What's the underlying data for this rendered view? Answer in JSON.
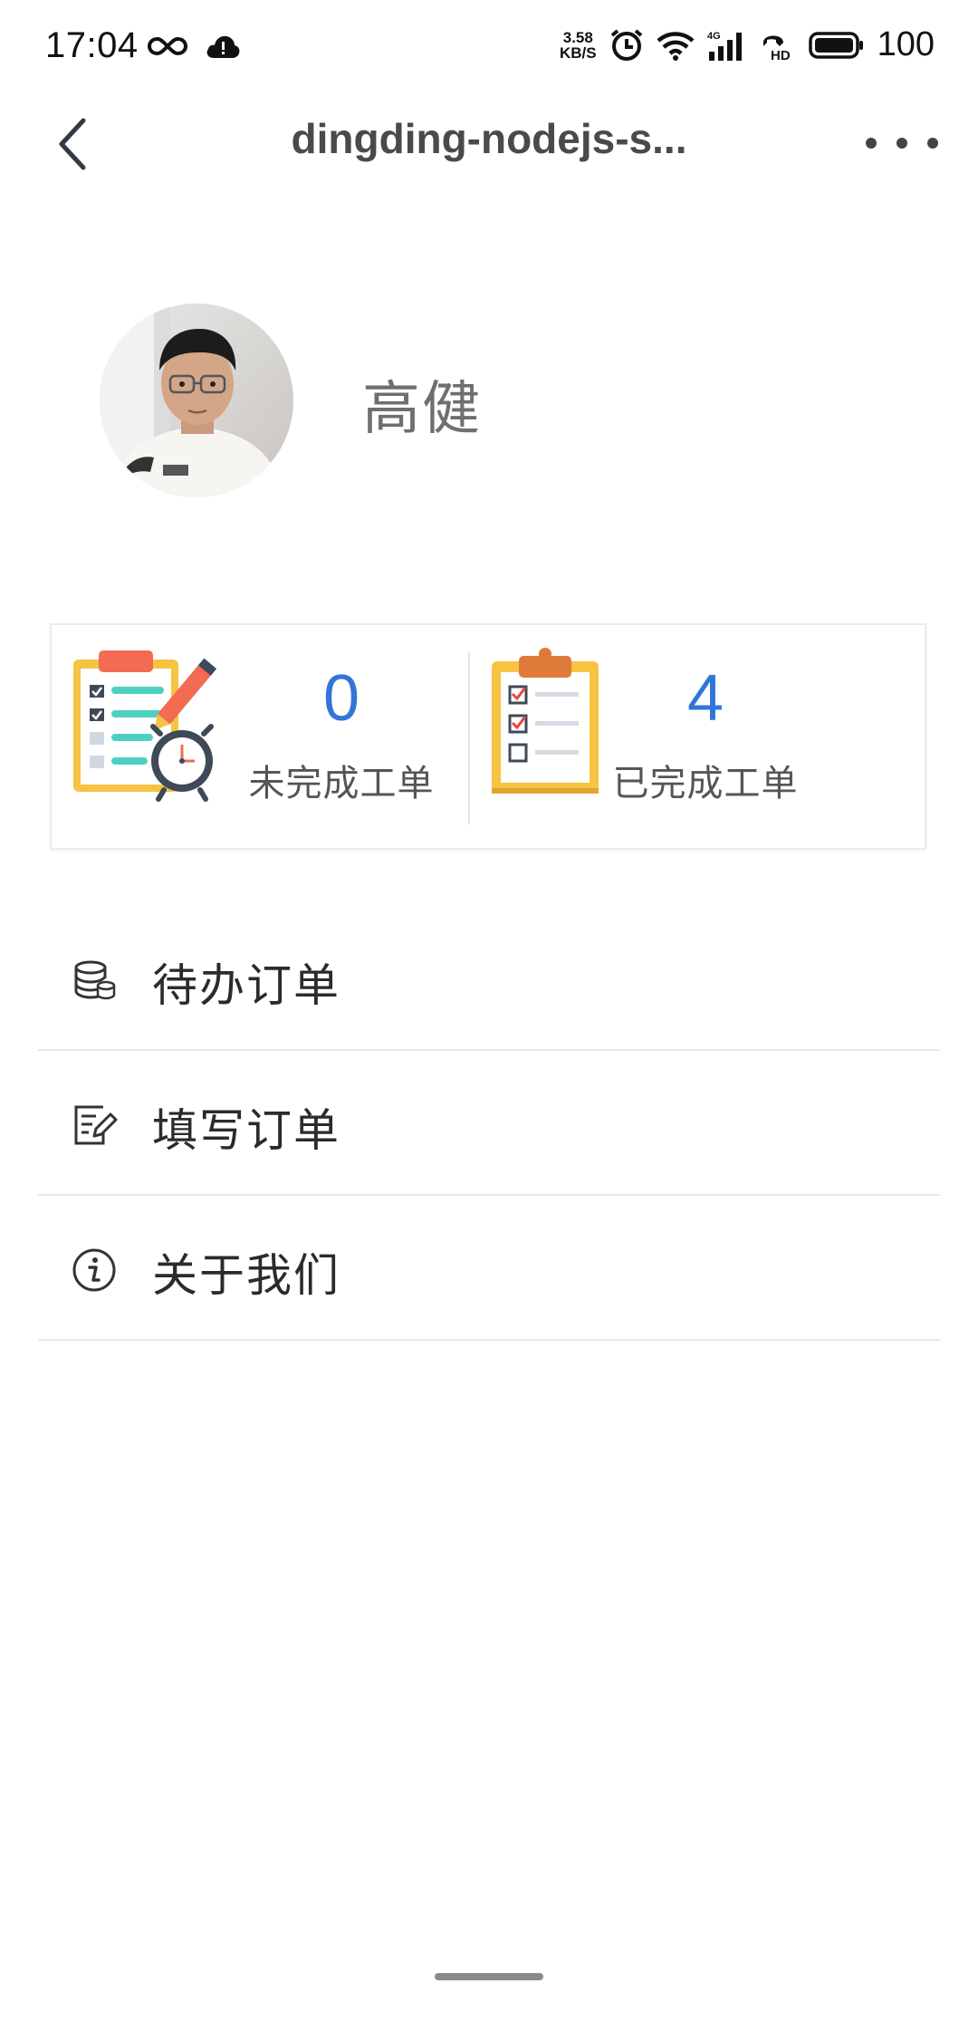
{
  "status_bar": {
    "time": "17:04",
    "net_speed_value": "3.58",
    "net_speed_unit": "KB/S",
    "network_label": "4G",
    "battery": "100",
    "icons": [
      "infinity-icon",
      "cloud-alert-icon",
      "alarm-icon",
      "wifi-icon",
      "signal-icon",
      "hd-call-icon",
      "battery-icon"
    ]
  },
  "header": {
    "title": "dingding-nodejs-s...",
    "back_icon": "chevron-left-icon",
    "more_icon": "more-dots-icon"
  },
  "profile": {
    "name": "高健",
    "avatar": "user-avatar-photo"
  },
  "stats": [
    {
      "value": "0",
      "label": "未完成工单",
      "icon": "checklist-clock-icon"
    },
    {
      "value": "4",
      "label": "已完成工单",
      "icon": "clipboard-check-icon"
    }
  ],
  "menu": [
    {
      "label": "待办订单",
      "icon": "database-icon"
    },
    {
      "label": "填写订单",
      "icon": "edit-form-icon"
    },
    {
      "label": "关于我们",
      "icon": "info-icon"
    }
  ],
  "colors": {
    "accent": "#3275d8",
    "divider": "#e8e8e8",
    "text": "#2b2b2b"
  }
}
